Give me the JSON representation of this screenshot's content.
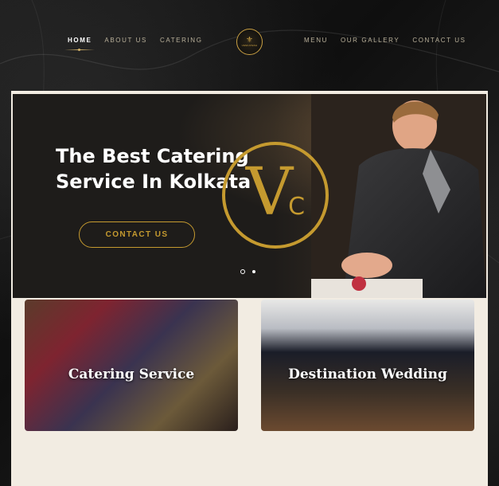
{
  "nav": {
    "left": [
      {
        "label": "HOME",
        "active": true
      },
      {
        "label": "ABOUT US"
      },
      {
        "label": "CATERING"
      }
    ],
    "right": [
      {
        "label": "MENU"
      },
      {
        "label": "OUR GALLERY"
      },
      {
        "label": "CONTACT US"
      }
    ],
    "logo": {
      "mark": "⚜",
      "brand": "VENKATESH"
    }
  },
  "hero": {
    "title_line1": "The Best Catering",
    "title_line2": "Service In Kolkata",
    "logo_v": "V",
    "logo_c": "C",
    "cta": "CONTACT US",
    "slides": 2,
    "active_slide": 1
  },
  "cards": [
    {
      "title": "Catering Service"
    },
    {
      "title": "Destination Wedding"
    }
  ],
  "colors": {
    "gold": "#c59a2f",
    "cream": "#f2ece2",
    "dark": "#151515"
  }
}
